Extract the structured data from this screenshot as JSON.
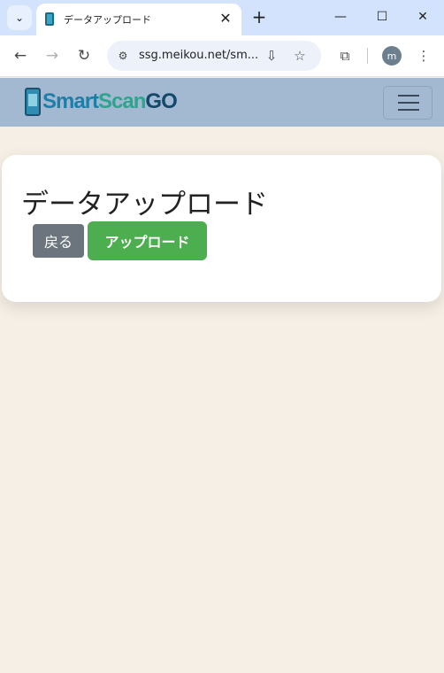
{
  "browser": {
    "tab_title": "データアップロード",
    "url": "ssg.meikou.net/sm...",
    "profile_initial": "m"
  },
  "icons": {
    "tab_search": "chevron-down-icon",
    "tab_close": "close-icon",
    "new_tab": "plus-icon",
    "back": "arrow-left-icon",
    "forward": "arrow-right-icon",
    "reload": "reload-icon",
    "site_info": "tune-icon",
    "install": "install-icon",
    "bookmark": "star-icon",
    "extensions": "puzzle-icon",
    "menu": "kebab-icon"
  },
  "page": {
    "logo": {
      "smart": "Smart",
      "scan": "Scan",
      "go": "GO"
    },
    "title": "データアップロード",
    "back_label": "戻る",
    "upload_label": "アップロード"
  },
  "colors": {
    "navbar": "#a3b8d1",
    "page_bg": "#f6efe5",
    "back_button": "#6c757d",
    "upload_button": "#4cae4f"
  }
}
